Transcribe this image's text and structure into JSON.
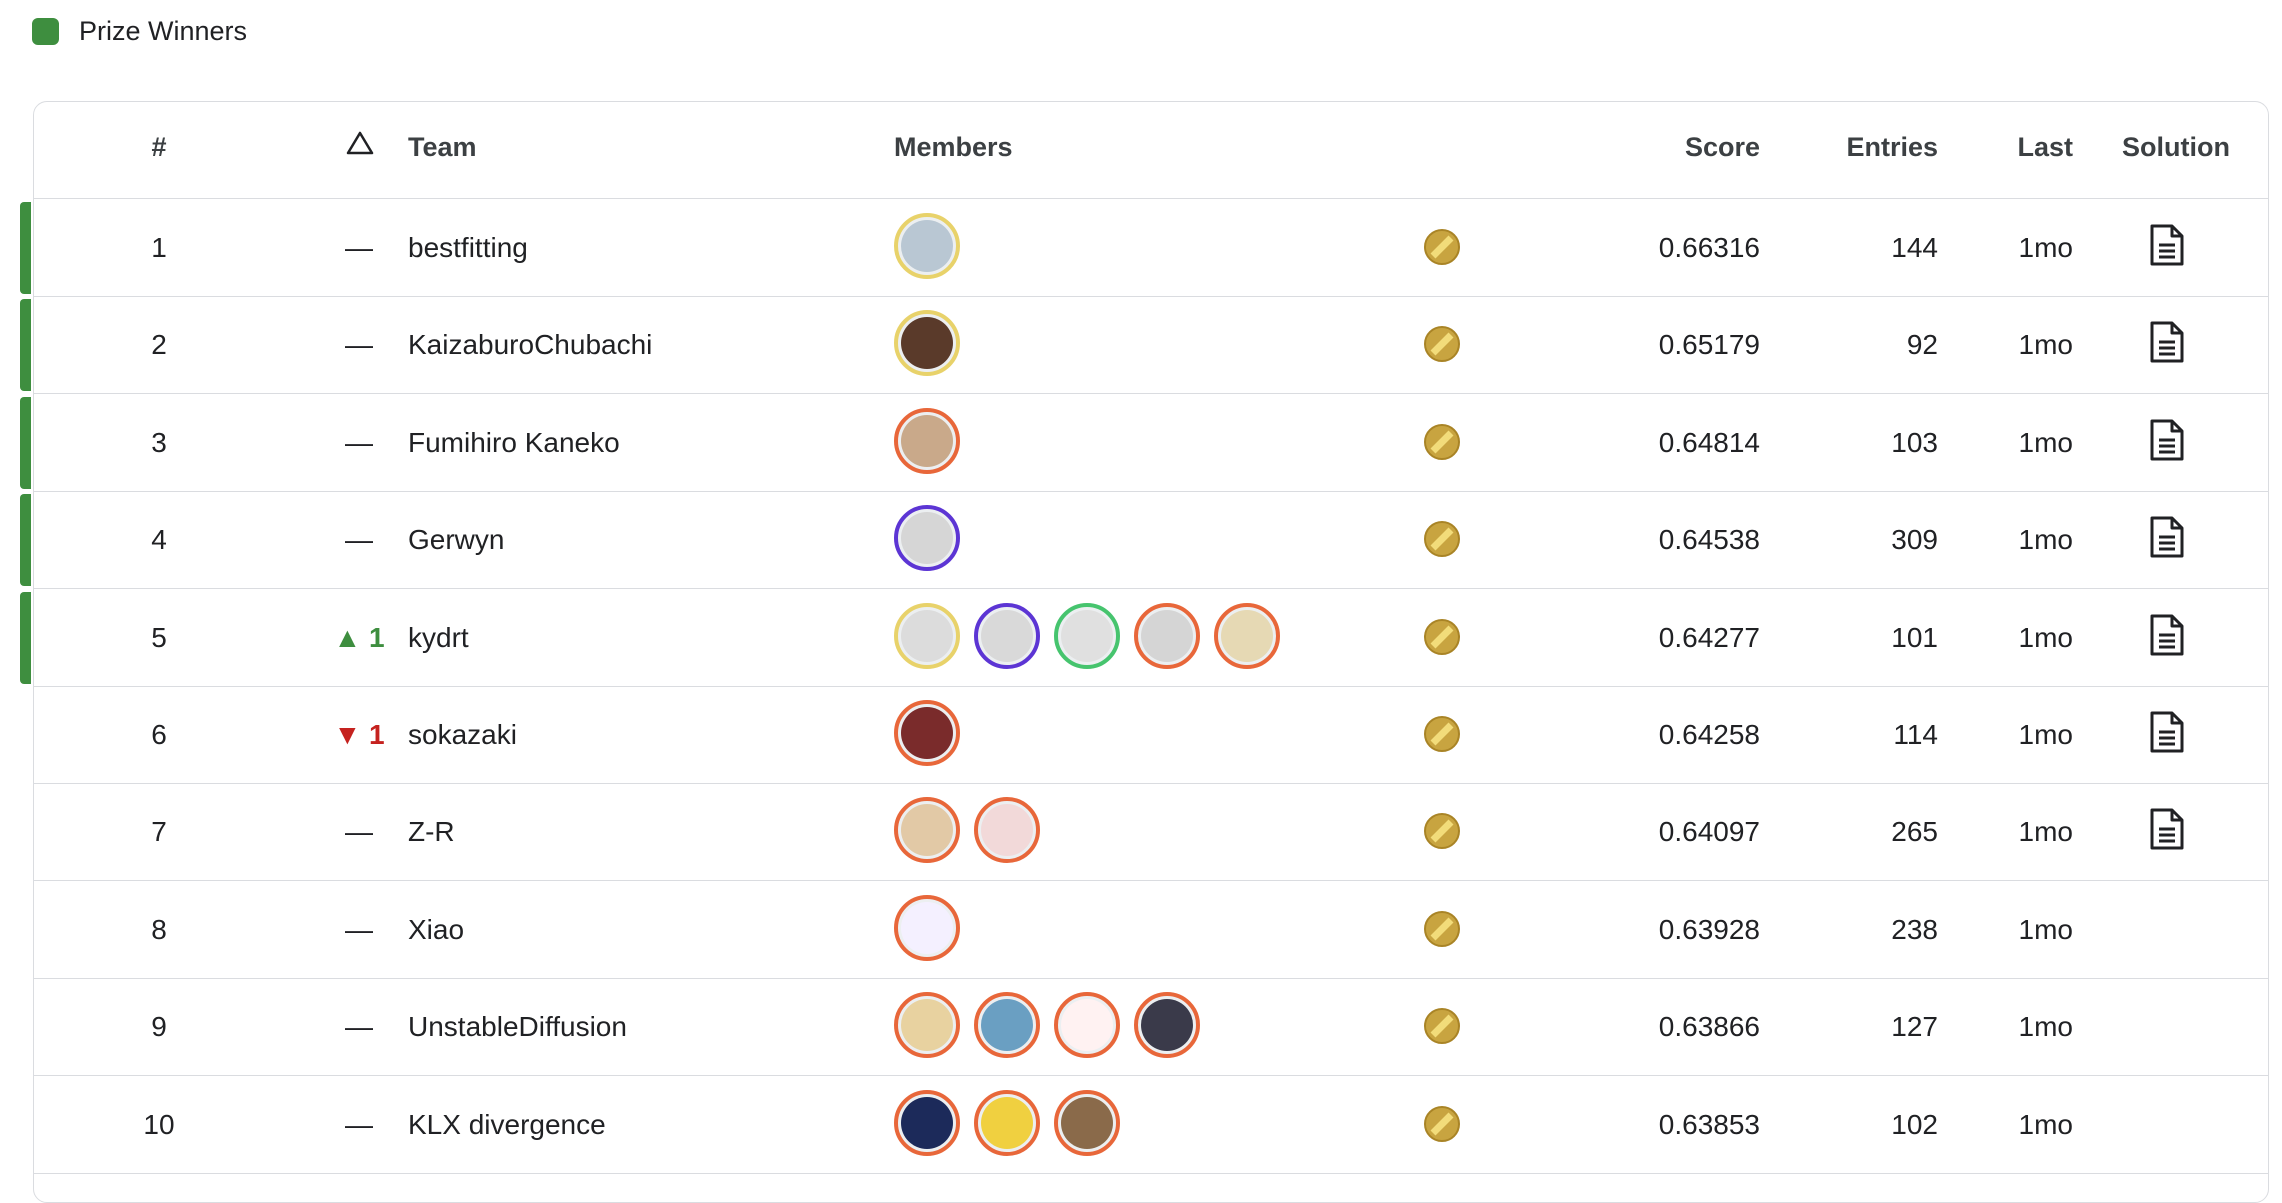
{
  "legend": {
    "label": "Prize Winners",
    "color": "#3e8e3f"
  },
  "header": {
    "rank": "#",
    "delta_icon": "triangle-outline-icon",
    "team": "Team",
    "members": "Members",
    "score": "Score",
    "entries": "Entries",
    "last": "Last",
    "solution": "Solution"
  },
  "rows": [
    {
      "rank": "1",
      "delta": "—",
      "team": "bestfitting",
      "score": "0.66316",
      "entries": "144",
      "last": "1mo",
      "prize": true,
      "solution": true
    },
    {
      "rank": "2",
      "delta": "—",
      "team": "KaizaburoChubachi",
      "score": "0.65179",
      "entries": "92",
      "last": "1mo",
      "prize": true,
      "solution": true
    },
    {
      "rank": "3",
      "delta": "—",
      "team": "Fumihiro Kaneko",
      "score": "0.64814",
      "entries": "103",
      "last": "1mo",
      "prize": true,
      "solution": true
    },
    {
      "rank": "4",
      "delta": "—",
      "team": "Gerwyn",
      "score": "0.64538",
      "entries": "309",
      "last": "1mo",
      "prize": true,
      "solution": true
    },
    {
      "rank": "5",
      "delta": "▲ 1",
      "team": "kydrt",
      "score": "0.64277",
      "entries": "101",
      "last": "1mo",
      "prize": true,
      "solution": true
    },
    {
      "rank": "6",
      "delta": "▼ 1",
      "team": "sokazaki",
      "score": "0.64258",
      "entries": "114",
      "last": "1mo",
      "prize": false,
      "solution": true
    },
    {
      "rank": "7",
      "delta": "—",
      "team": "Z-R",
      "score": "0.64097",
      "entries": "265",
      "last": "1mo",
      "prize": false,
      "solution": true
    },
    {
      "rank": "8",
      "delta": "—",
      "team": "Xiao",
      "score": "0.63928",
      "entries": "238",
      "last": "1mo",
      "prize": false,
      "solution": false
    },
    {
      "rank": "9",
      "delta": "—",
      "team": "UnstableDiffusion",
      "score": "0.63866",
      "entries": "127",
      "last": "1mo",
      "prize": false,
      "solution": false
    },
    {
      "rank": "10",
      "delta": "—",
      "team": "KLX divergence",
      "score": "0.63853",
      "entries": "102",
      "last": "1mo",
      "prize": false,
      "solution": false
    }
  ],
  "icons": {
    "medal": "gold-medal-icon",
    "solution": "document-icon"
  },
  "colors": {
    "prize": "#3e8e3f",
    "up": "#3e8e3f",
    "down": "#c5221f",
    "gold_ring": "#e8d26a",
    "orange_ring": "#e8673a",
    "purple_ring": "#5c35d4",
    "green_ring": "#46c46e",
    "medal": "#c8a440"
  }
}
